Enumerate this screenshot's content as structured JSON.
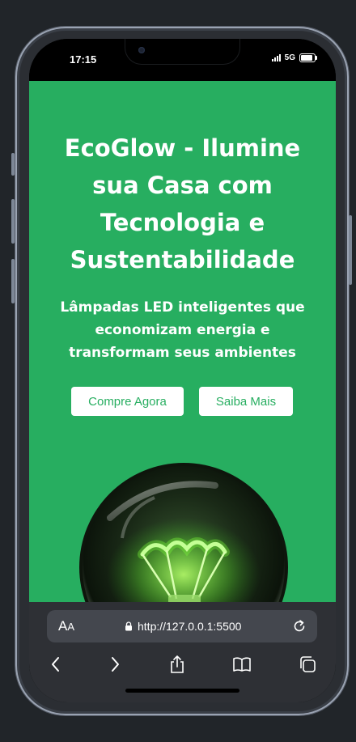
{
  "status_bar": {
    "time": "17:15",
    "network": "5G",
    "battery_level": 0.85
  },
  "hero": {
    "title": "EcoGlow - Ilumine sua Casa com Tecnologia e Sustentabilidade",
    "subtitle": "Lâmpadas LED inteligentes que economizam energia e transformam seus ambientes",
    "primary_button": "Compre Agora",
    "secondary_button": "Saiba Mais",
    "image_icon": "light-bulb-image"
  },
  "browser": {
    "text_size_label": "A",
    "text_size_label_small": "A",
    "url": "http://127.0.0.1:5500",
    "icons": [
      "lock-icon",
      "reload-icon",
      "back-icon",
      "forward-icon",
      "share-icon",
      "bookmarks-icon",
      "tabs-icon"
    ]
  },
  "colors": {
    "brand_green": "#27ae60",
    "button_text": "#27ae60",
    "browser_bar": "#2e3035"
  }
}
